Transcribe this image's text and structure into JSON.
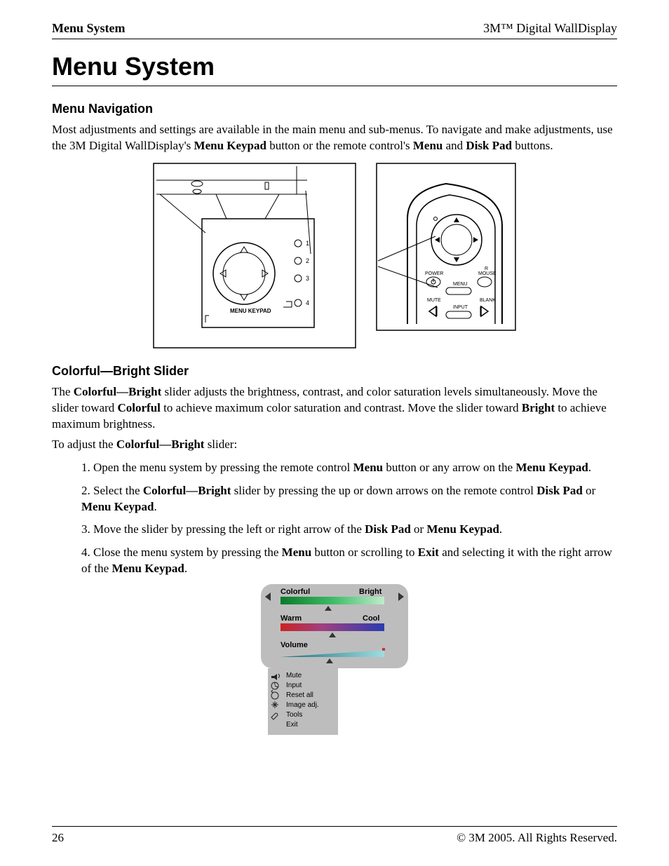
{
  "header": {
    "left": "Menu System",
    "right": "3M™ Digital WallDisplay"
  },
  "title": "Menu System",
  "sections": {
    "nav": {
      "heading": "Menu Navigation",
      "para_pre": "Most adjustments and settings are available in the main menu and sub-menus. To navigate and make adjustments, use the 3M Digital WallDisplay's ",
      "bold1": "Menu Keypad",
      "mid1": " button or the remote control's ",
      "bold2": "Menu",
      "mid2": " and ",
      "bold3": "Disk Pad",
      "post": " buttons."
    },
    "slider": {
      "heading": "Colorful—Bright Slider",
      "p1_pre": "The ",
      "p1_b1": "Colorful—Bright",
      "p1_mid1": " slider adjusts the brightness, contrast, and color saturation levels simultaneously. Move the slider toward ",
      "p1_b2": "Colorful",
      "p1_mid2": " to achieve maximum color saturation and contrast. Move the slider toward ",
      "p1_b3": "Bright",
      "p1_post": " to achieve maximum brightness.",
      "p2_pre": "To adjust the ",
      "p2_b": "Colorful—Bright",
      "p2_post": " slider:",
      "steps": [
        {
          "n": "1.",
          "pre": "Open the menu system by pressing the remote control ",
          "b1": "Menu",
          "mid": " button or any arrow on the ",
          "b2": "Menu Keypad",
          "post": "."
        },
        {
          "n": "2.",
          "pre": "Select the ",
          "b1": "Colorful—Bright",
          "mid": " slider by pressing the up or down arrows on the remote control ",
          "b2": "Disk Pad",
          "mid2": " or ",
          "b3": "Menu Keypad",
          "post": "."
        },
        {
          "n": "3.",
          "pre": "Move the slider by pressing the left or right arrow of the ",
          "b1": "Disk Pad",
          "mid": " or ",
          "b2": "Menu Keypad",
          "post": "."
        },
        {
          "n": "4.",
          "pre": "Close the menu system by pressing the ",
          "b1": "Menu",
          "mid": " button or scrolling to ",
          "b2": "Exit",
          "mid2": " and selecting it with the right arrow of the ",
          "b3": "Menu Keypad",
          "post": "."
        }
      ]
    }
  },
  "keypad": {
    "label": "MENU KEYPAD",
    "numbers": [
      "1",
      "2",
      "3",
      "4"
    ]
  },
  "remote": {
    "power": "POWER",
    "rmouse1": "R",
    "rmouse2": "MOUSE",
    "menu": "MENU",
    "mute": "MUTE",
    "blank": "BLANK",
    "input": "INPUT"
  },
  "osd": {
    "slider1": {
      "left": "Colorful",
      "right": "Bright"
    },
    "slider2": {
      "left": "Warm",
      "right": "Cool"
    },
    "slider3": {
      "left": "Volume"
    },
    "items": [
      "Mute",
      "Input",
      "Reset all",
      "Image adj.",
      "Tools",
      "Exit"
    ]
  },
  "footer": {
    "page": "26",
    "copyright": "© 3M 2005. All Rights Reserved."
  }
}
